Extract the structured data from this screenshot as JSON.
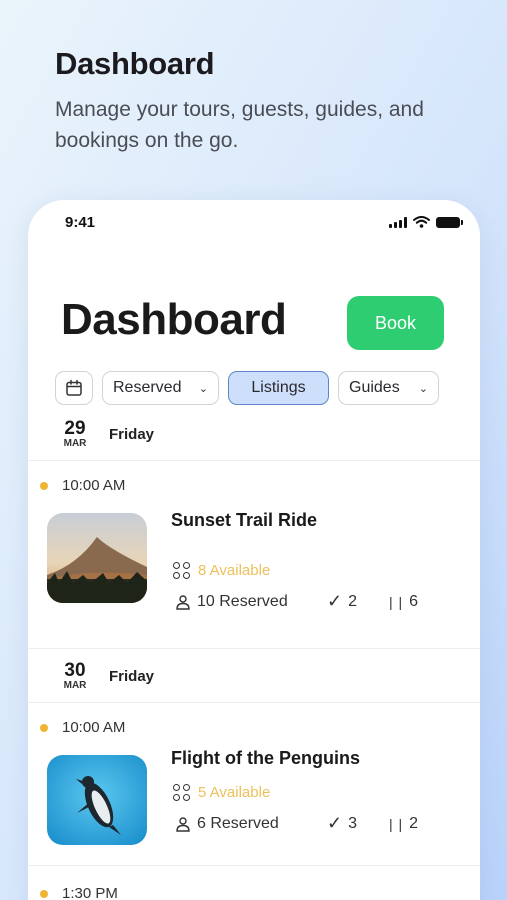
{
  "promo": {
    "title": "Dashboard",
    "subtitle": "Manage your tours, guests, guides, and bookings on the go."
  },
  "status_bar": {
    "time": "9:41"
  },
  "header": {
    "title": "Dashboard",
    "book_label": "Book"
  },
  "filters": {
    "reserved": "Reserved",
    "listings": "Listings",
    "guides": "Guides",
    "active": "Listings"
  },
  "days": [
    {
      "day": "29",
      "month": "MAR",
      "weekday": "Friday"
    },
    {
      "day": "30",
      "month": "MAR",
      "weekday": "Friday"
    }
  ],
  "listings": [
    {
      "time": "10:00 AM",
      "title": "Sunset Trail Ride",
      "available": "8 Available",
      "reserved": "10 Reserved",
      "checked": "2",
      "paused": "6"
    },
    {
      "time": "10:00 AM",
      "title": "Flight of the Penguins",
      "available": "5 Available",
      "reserved": "6 Reserved",
      "checked": "3",
      "paused": "2"
    }
  ],
  "next_time": "1:30 PM",
  "colors": {
    "book": "#2fcd71",
    "available": "#eec05c",
    "dot": "#f0b432",
    "active_chip": "#cddffb"
  }
}
